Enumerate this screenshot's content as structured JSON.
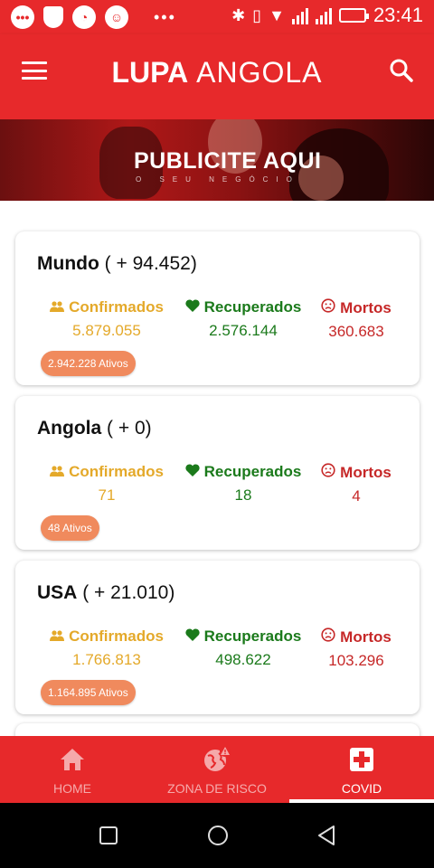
{
  "status_bar": {
    "time": "23:41"
  },
  "header": {
    "logo_bold": "LUPA",
    "logo_thin": "ANGOLA"
  },
  "banner": {
    "title": "PUBLICITE AQUI",
    "subtitle": "O SEU NEGÓCIO"
  },
  "stats_labels": {
    "confirmed": "Confirmados",
    "recovered": "Recuperados",
    "deaths": "Mortos"
  },
  "cards": [
    {
      "name": "Mundo",
      "delta": "( + 94.452)",
      "confirmed": "5.879.055",
      "recovered": "2.576.144",
      "deaths": "360.683",
      "active": "2.942.228 Ativos"
    },
    {
      "name": "Angola",
      "delta": "( + 0)",
      "confirmed": "71",
      "recovered": "18",
      "deaths": "4",
      "active": "48 Ativos"
    },
    {
      "name": "USA",
      "delta": "( + 21.010)",
      "confirmed": "1.766.813",
      "recovered": "498.622",
      "deaths": "103.296",
      "active": "1.164.895 Ativos"
    }
  ],
  "bottom_nav": {
    "home": "HOME",
    "risk_zone": "ZONA DE RISCO",
    "covid": "COVID"
  },
  "colors": {
    "primary": "#e7292b",
    "confirmed": "#e4a92a",
    "recovered": "#1b7a1b",
    "deaths": "#c62828",
    "badge": "#f08a5d"
  }
}
